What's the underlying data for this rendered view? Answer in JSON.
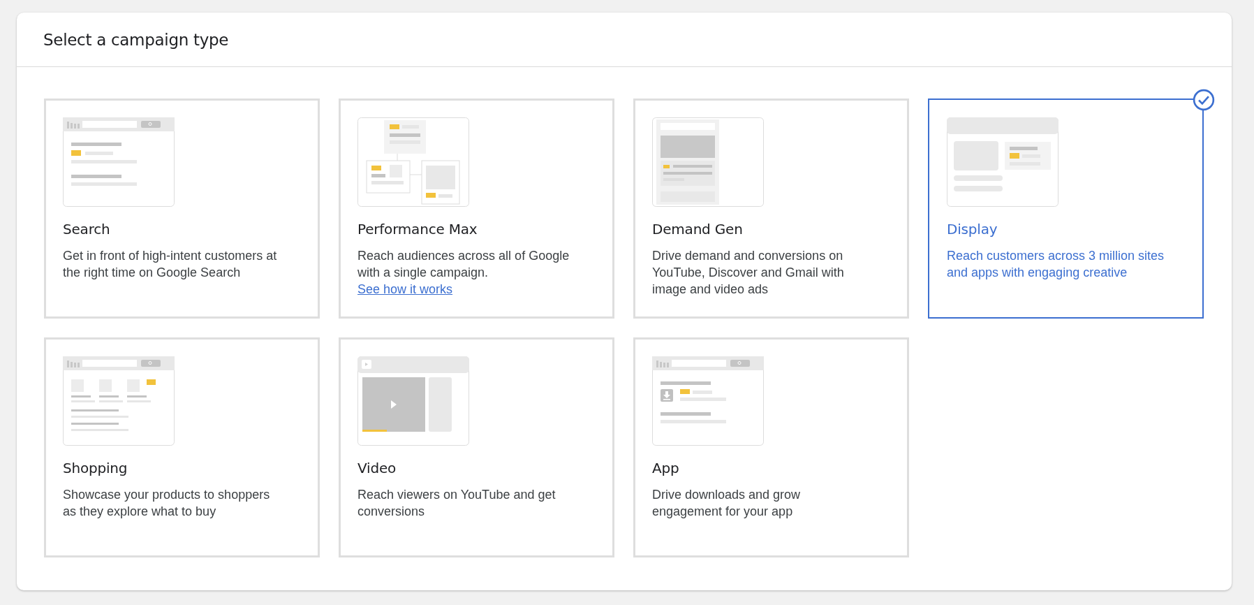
{
  "dialog": {
    "title": "Select a campaign type"
  },
  "campaign_types": [
    {
      "kind": "search",
      "title": "Search",
      "description": "Get in front of high-intent customers at the right time on Google Search",
      "selected": false
    },
    {
      "kind": "performance_max",
      "title": "Performance Max",
      "description": "Reach audiences across all of Google with a single campaign.",
      "link": "See how it works",
      "selected": false
    },
    {
      "kind": "demand_gen",
      "title": "Demand Gen",
      "description": "Drive demand and conversions on YouTube, Discover and Gmail with image and video ads",
      "selected": false
    },
    {
      "kind": "display",
      "title": "Display",
      "description": "Reach customers across 3 million sites and apps with engaging creative",
      "selected": true
    },
    {
      "kind": "shopping",
      "title": "Shopping",
      "description": "Showcase your products to shoppers as they explore what to buy",
      "selected": false
    },
    {
      "kind": "video",
      "title": "Video",
      "description": "Reach viewers on YouTube and get conversions",
      "selected": false
    },
    {
      "kind": "app",
      "title": "App",
      "description": "Drive downloads and grow engagement for your app",
      "selected": false
    }
  ]
}
